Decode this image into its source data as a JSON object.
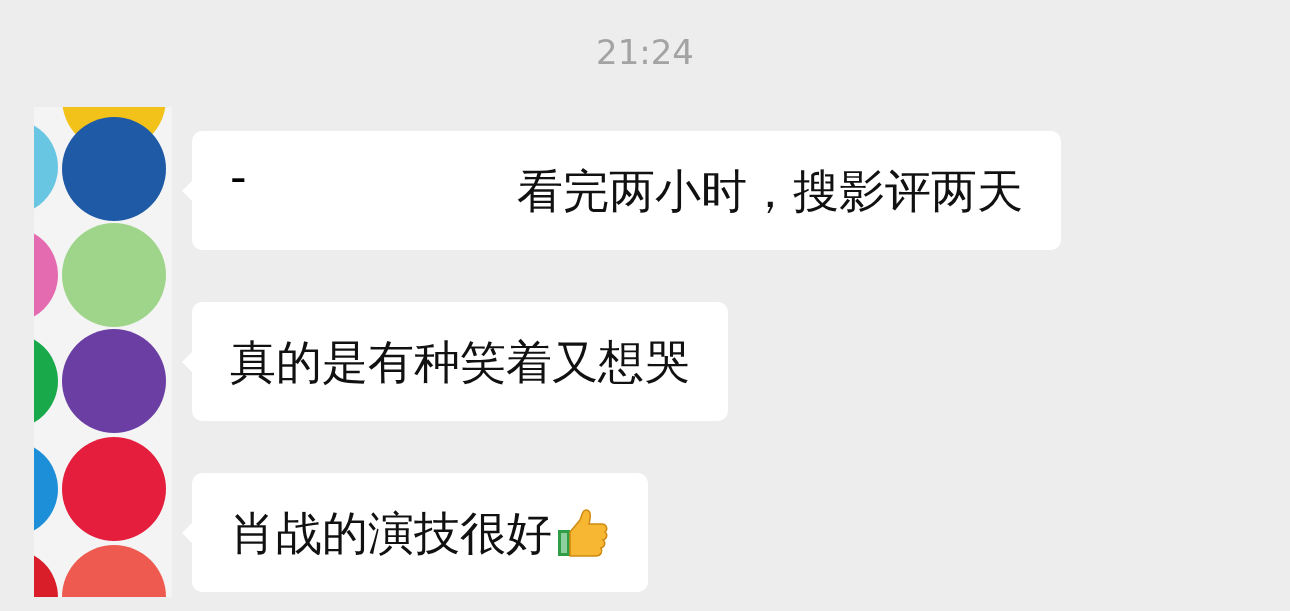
{
  "timestamp": "21:24",
  "messages": [
    {
      "prefix": "-",
      "text": "看完两小时，搜影评两天",
      "emoji": false
    },
    {
      "text": "真的是有种笑着又想哭",
      "emoji": false
    },
    {
      "text": "肖战的演技很好",
      "emoji": true
    }
  ]
}
